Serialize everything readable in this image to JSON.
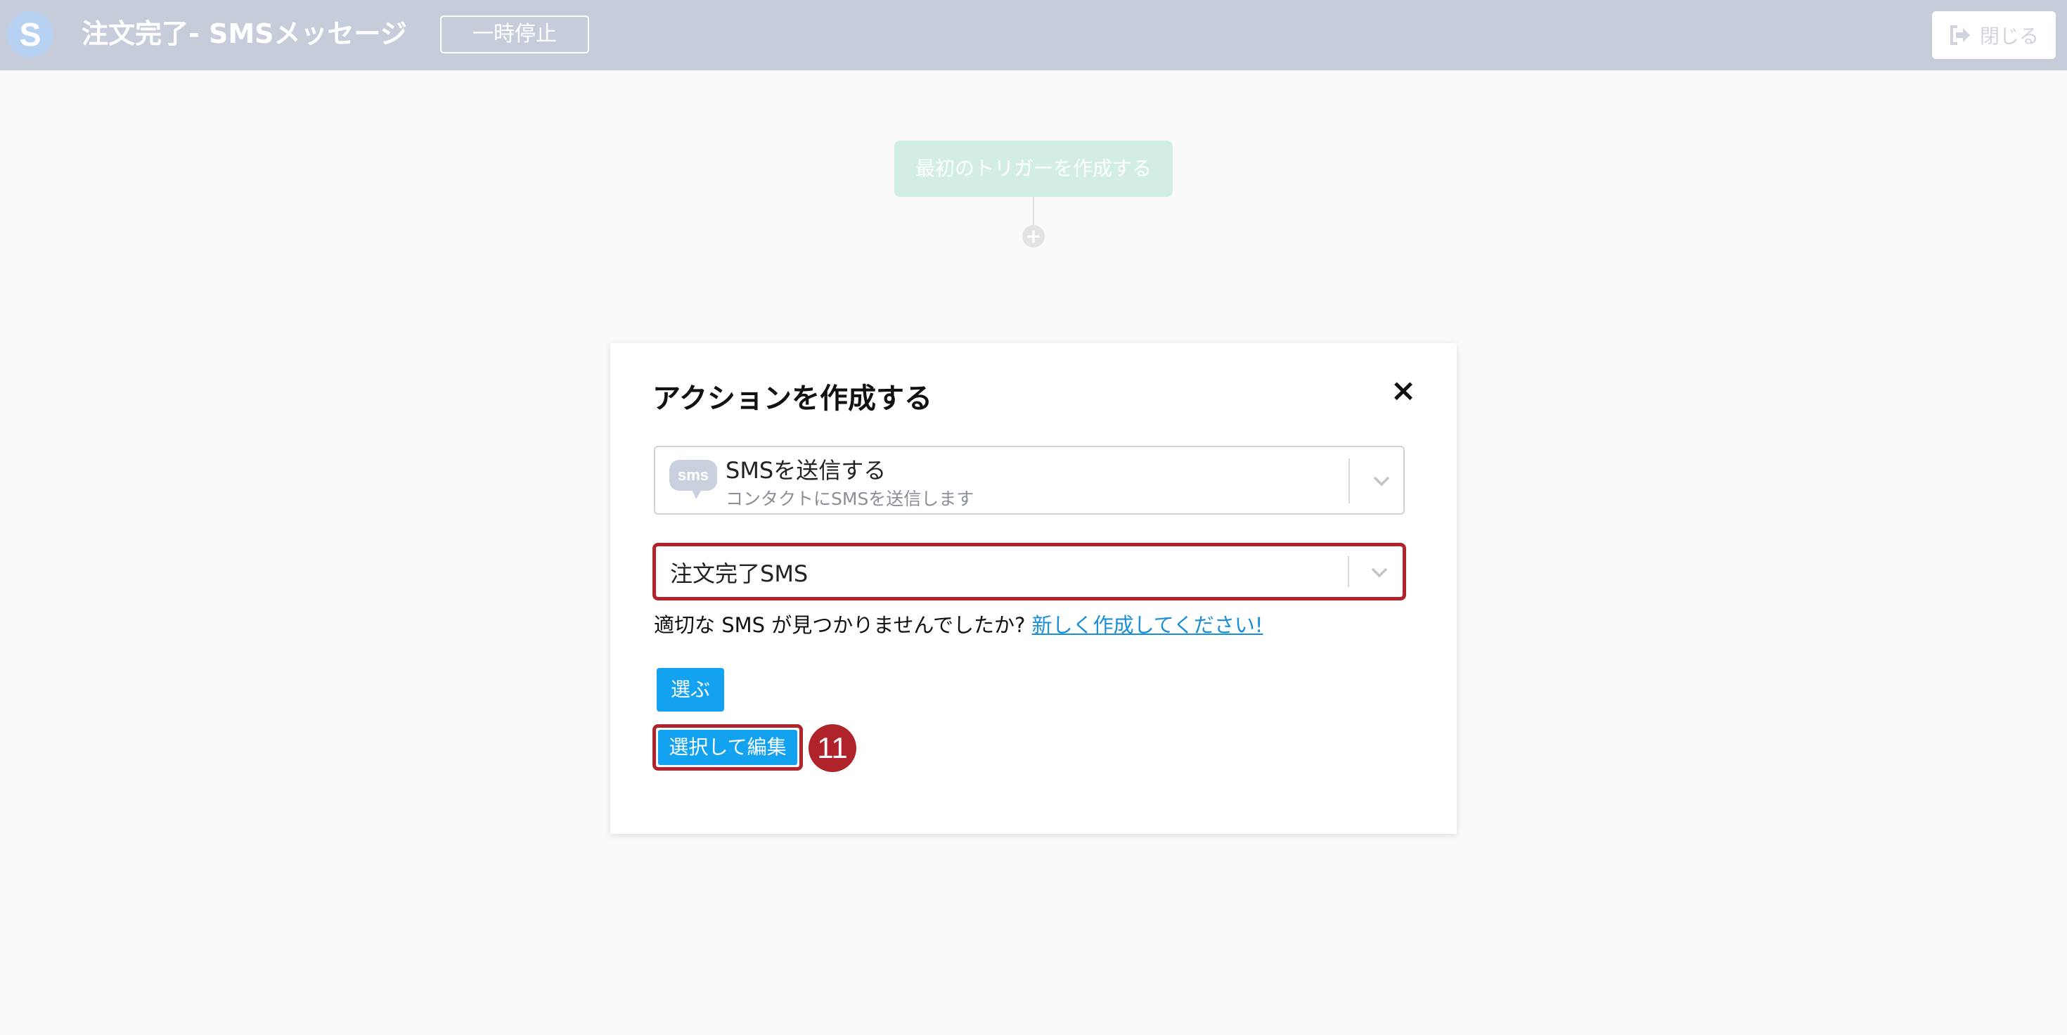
{
  "header": {
    "logo_letter": "S",
    "title": "注文完了- SMSメッセージ",
    "pause_label": "一時停止",
    "close_label": "閉じる",
    "close_icon": "sign-out-icon"
  },
  "canvas": {
    "trigger_label": "最初のトリガーを作成する",
    "add_icon": "plus-icon"
  },
  "modal": {
    "title": "アクションを作成する",
    "close_symbol": "×",
    "action_select": {
      "icon_text": "sms",
      "label": "SMSを送信する",
      "sublabel": "コンタクトにSMSを送信します"
    },
    "sms_select": {
      "value": "注文完了SMS"
    },
    "hint_text": "適切な SMS が見つかりませんでしたか? ",
    "hint_link": "新しく作成してください!",
    "choose_label": "選ぶ",
    "choose_edit_label": "選択して編集",
    "step_badge": "11"
  },
  "colors": {
    "header_bg": "#c6ccd9",
    "primary_button": "#13a2f0",
    "highlight": "#b1232b",
    "link": "#1a8fd8"
  }
}
